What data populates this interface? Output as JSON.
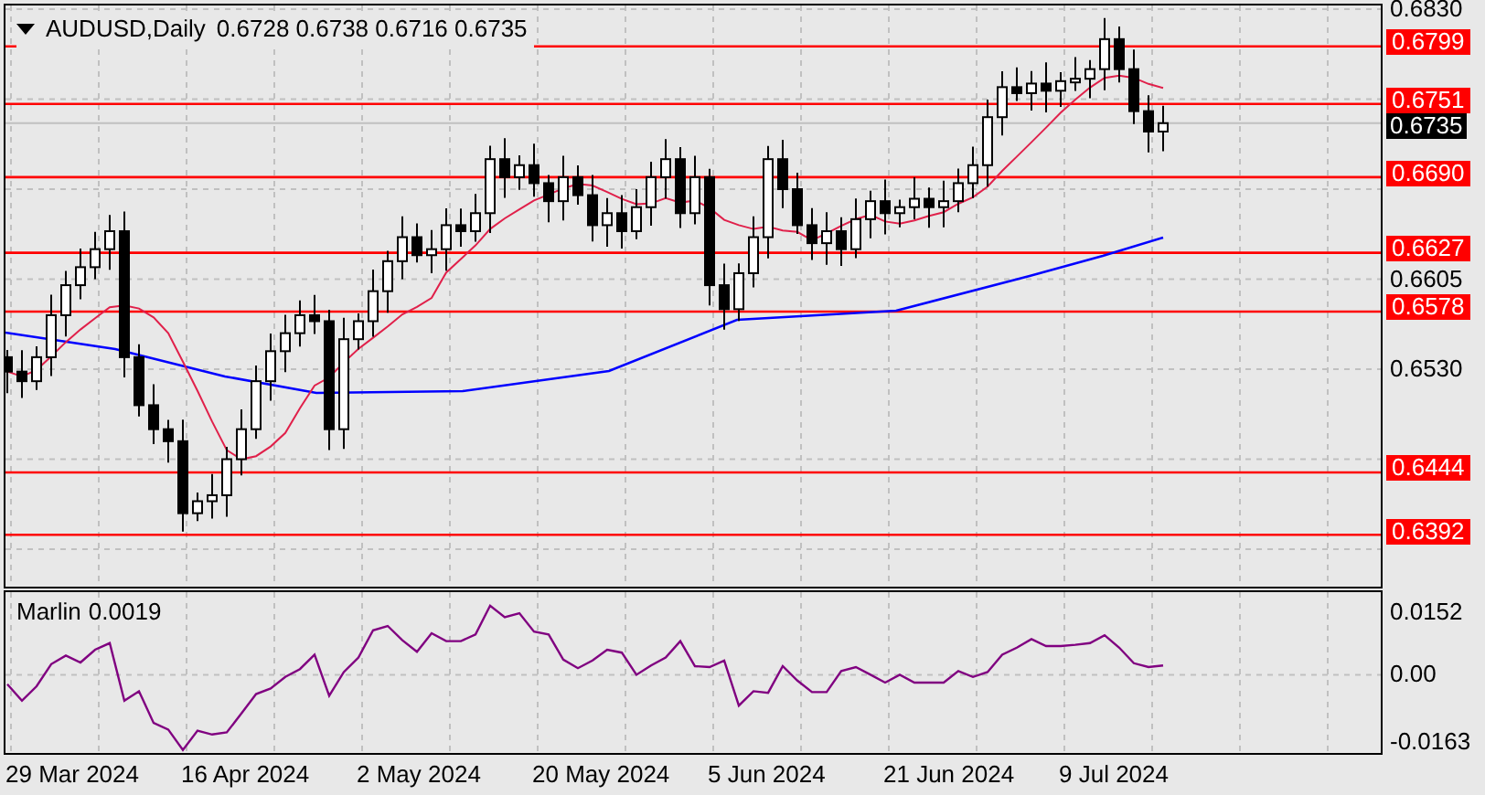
{
  "header": {
    "symbol": "AUDUSD,Daily",
    "ohlc": [
      "0.6728",
      "0.6738",
      "0.6716",
      "0.6735"
    ]
  },
  "price_axis": {
    "ticks": [
      "0.6830",
      "0.6605",
      "0.6530"
    ],
    "current_price": "0.6735"
  },
  "levels": [
    {
      "label": "0.6799"
    },
    {
      "label": "0.6751"
    },
    {
      "label": "0.6690"
    },
    {
      "label": "0.6627"
    },
    {
      "label": "0.6578"
    },
    {
      "label": "0.6444"
    },
    {
      "label": "0.6392"
    }
  ],
  "indicator": {
    "reading": "0.0019",
    "chart_data": {
      "type": "line",
      "ylim": [
        -0.019,
        0.0201
      ],
      "yticks": [
        {
          "value": 0.0152,
          "label": "0.0152"
        },
        {
          "value": 0,
          "label": "0.00"
        },
        {
          "value": -0.0163,
          "label": "-0.0163"
        }
      ],
      "series": [
        {
          "name": "Marlin",
          "color": "#800080",
          "values": [
            -0.0023,
            -0.0063,
            -0.0028,
            0.0026,
            0.0047,
            0.003,
            0.0061,
            0.0077,
            -0.0063,
            -0.004,
            -0.0117,
            -0.0133,
            -0.0183,
            -0.0136,
            -0.0145,
            -0.014,
            -0.0094,
            -0.0047,
            -0.0033,
            -0.0005,
            0.0014,
            0.0049,
            -0.0051,
            0.0007,
            0.0042,
            0.0108,
            0.0119,
            0.0084,
            0.0056,
            0.0101,
            0.0082,
            0.0082,
            0.0098,
            0.0168,
            0.014,
            0.015,
            0.0105,
            0.0098,
            0.0037,
            0.0016,
            0.0035,
            0.0061,
            0.0054,
            0.0,
            0.0023,
            0.0042,
            0.0082,
            0.0021,
            0.0019,
            0.0035,
            -0.0075,
            -0.004,
            -0.0044,
            0.0021,
            -0.0014,
            -0.0042,
            -0.0042,
            0.0009,
            0.0019,
            0.0,
            -0.0019,
            0.0,
            -0.0019,
            -0.0019,
            -0.0019,
            0.0009,
            -0.0005,
            0.0007,
            0.0049,
            0.0066,
            0.0087,
            0.007,
            0.007,
            0.0073,
            0.0077,
            0.0096,
            0.0066,
            0.0028,
            0.0019,
            0.0023
          ]
        }
      ]
    }
  },
  "time_axis": [
    "29 Mar 2024",
    "16 Apr 2024",
    "2 May 2024",
    "20 May 2024",
    "5 Jun 2024",
    "21 Jun 2024",
    "9 Jul 2024"
  ]
}
